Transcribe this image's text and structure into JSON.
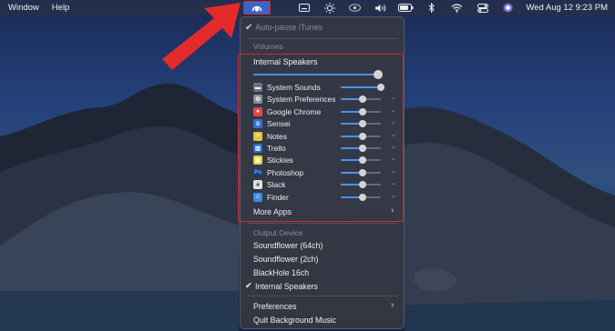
{
  "menubar": {
    "left_items": [
      "Window",
      "Help"
    ],
    "clock": "Wed Aug 12  9:23 PM",
    "icons": [
      "background-music-icon",
      "keyboard-icon",
      "brightness-icon",
      "eye-icon",
      "volume-icon",
      "battery-icon",
      "bluetooth-icon",
      "wifi-icon",
      "control-center-icon",
      "siri-icon"
    ]
  },
  "menu": {
    "auto_pause": "Auto-pause iTunes",
    "volumes_header": "Volumes",
    "internal_speakers_label": "Internal Speakers",
    "master_volume": 1.0,
    "apps": [
      {
        "name": "System Sounds",
        "level": 1.0,
        "icon": "system-sounds-icon",
        "color": "#6e7280"
      },
      {
        "name": "System Preferences",
        "level": 0.55,
        "icon": "system-preferences-icon",
        "color": "#8a8e98"
      },
      {
        "name": "Google Chrome",
        "level": 0.55,
        "icon": "chrome-icon",
        "color": "#e8453c"
      },
      {
        "name": "Sensei",
        "level": 0.55,
        "icon": "sensei-icon",
        "color": "#2f6fd6"
      },
      {
        "name": "Notes",
        "level": 0.55,
        "icon": "notes-icon",
        "color": "#e6c340"
      },
      {
        "name": "Trello",
        "level": 0.55,
        "icon": "trello-icon",
        "color": "#1c6fd0"
      },
      {
        "name": "Stickies",
        "level": 0.55,
        "icon": "stickies-icon",
        "color": "#e8cf3a"
      },
      {
        "name": "Photoshop",
        "level": 0.55,
        "icon": "photoshop-icon",
        "color": "#1d3b6e"
      },
      {
        "name": "Slack",
        "level": 0.55,
        "icon": "slack-icon",
        "color": "#e0e0e0"
      },
      {
        "name": "Finder",
        "level": 0.55,
        "icon": "finder-icon",
        "color": "#3c8de0"
      }
    ],
    "more_apps": "More Apps",
    "output_header": "Output Device",
    "devices": [
      "Soundflower (64ch)",
      "Soundflower (2ch)",
      "BlackHole 16ch",
      "Internal Speakers"
    ],
    "selected_device": "Internal Speakers",
    "preferences": "Preferences",
    "quit": "Quit Background Music"
  },
  "colors": {
    "highlight": "#d5262c",
    "accent": "#4d8ff0"
  }
}
